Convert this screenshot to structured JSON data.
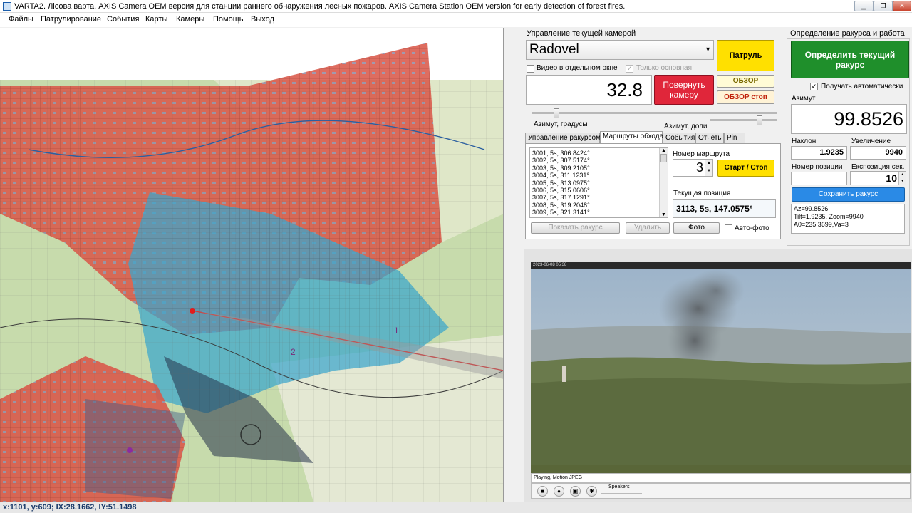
{
  "window": {
    "title": "VARTA2. Лісова варта. AXIS Camera OEM версия для станции раннего обнаружения лесных пожаров. AXIS Camera Station OEM version for early detection of forest fires."
  },
  "menu": [
    "Файлы",
    "Патрулирование",
    "События",
    "Карты",
    "Камеры",
    "Помощь",
    "Выход"
  ],
  "camera_control": {
    "section_title": "Управление текущей камерой",
    "camera_name": "Radovel",
    "patrol_label": "Патруль",
    "video_separate_label": "Видео в отдельном окне",
    "only_main_label": "Только основная",
    "azimuth_value": "32.8",
    "rotate_label": "Повернуть камеру",
    "overview_label": "ОБЗОР",
    "overview_stop_label": "ОБЗОР стоп",
    "azimuth_degrees_label": "Азимут, градусы",
    "azimuth_fraction_label": "Азимут, доли",
    "tabs": [
      "Управление ракурсом",
      "Маршруты обхода",
      "События",
      "Отчеты",
      "Pin"
    ],
    "route_list": [
      "3001, 5s, 306.8424°",
      "3002, 5s, 307.5174°",
      "3003, 5s, 309.2105°",
      "3004, 5s, 311.1231°",
      "3005, 5s, 313.0975°",
      "3006, 5s, 315.0606°",
      "3007, 5s, 317.1291°",
      "3008, 5s, 319.2048°",
      "3009, 5s, 321.3141°"
    ],
    "route_number_label": "Номер маршрута",
    "route_number": "3",
    "start_stop_label": "Старт / Стоп",
    "current_position_label": "Текущая позиция",
    "current_position": "3113, 5s, 147.0575°",
    "show_view_label": "Показать ракурс",
    "delete_label": "Удалить",
    "photo_label": "Фото",
    "auto_photo_label": "Авто-фото"
  },
  "view_define": {
    "section_title": "Определение ракурса и работа",
    "define_button": "Определить текущий ракурс",
    "auto_receive_label": "Получать автоматически",
    "azimuth_label": "Азимут",
    "azimuth": "99.8526",
    "tilt_label": "Наклон",
    "tilt": "1.9235",
    "zoom_label": "Увеличение",
    "zoom": "9940",
    "position_number_label": "Номер позиции",
    "exposure_label": "Експозиция сек.",
    "exposure": "10",
    "save_label": "Сохранить ракурс",
    "info_lines": [
      "Az=99.8526",
      "Tilt=1.9235, Zoom=9940",
      "A0=235.3699,Va=3"
    ]
  },
  "video": {
    "top_text": "2023-06-08 05:38",
    "status": "Playing, Motion JPEG",
    "speakers_label": "Speakers"
  },
  "map": {
    "label_1": "1",
    "label_2": "2"
  },
  "statusbar": {
    "coords": "x:1101, y:609; IX:28.1662, IY:51.1498"
  },
  "colors": {
    "patrol_yellow": "#ffe000",
    "rotate_red": "#e0263a",
    "define_green": "#1f8f2b",
    "save_blue": "#2a8ae6",
    "smoke_sky": "#a8b8c8"
  }
}
